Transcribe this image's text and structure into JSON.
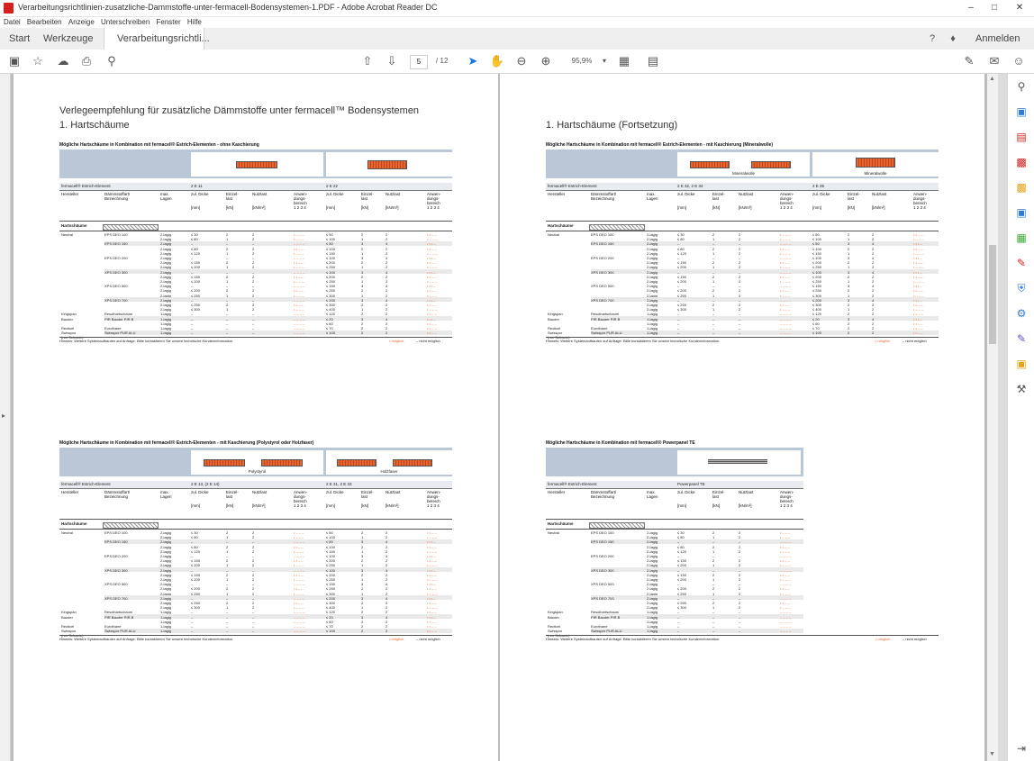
{
  "window": {
    "title": "Verarbeitungsrichtlinien-zusatzliche-Dammstoffe-unter-fermacell-Bodensystemen-1.PDF - Adobe Acrobat Reader DC"
  },
  "menu": [
    "Datei",
    "Bearbeiten",
    "Anzeige",
    "Unterschreiben",
    "Fenster",
    "Hilfe"
  ],
  "tabs": {
    "start": "Start",
    "werkzeuge": "Werkzeuge",
    "doc": "Verarbeitungsrichtli...",
    "close": "×"
  },
  "header_right": {
    "signin": "Anmelden"
  },
  "toolbar": {
    "page_current": "5",
    "page_sep": "/",
    "page_total": "12",
    "zoom": "95,9%"
  },
  "page_left": {
    "title1": "Verlegeempfehlung für zusätzliche Dämmstoffe unter fermacell™ Bodensystemen",
    "title2": "1. Hartschäume",
    "t1": {
      "caption": "Mögliche Hartschäume in Kombination mit fermacell® Estrich-Elementen - ohne Kaschierung",
      "elem_label": "fermacell® Estrich-Element",
      "elem_a": "2 E 11",
      "elem_b": "2 E 22"
    },
    "t2": {
      "caption": "Mögliche Hartschäume in Kombination mit fermacell® Estrich-Elementen - mit Kaschierung (Polystyrol oder Holzfaser)",
      "elem_label": "fermacell® Estrich-Element",
      "elem_a": "2 E 13, (2 E 14)",
      "elem_b": "2 E 31, 2 E 33",
      "img_a": "Polystyrol",
      "img_b": "Holzfaser"
    }
  },
  "page_right": {
    "title2": "1. Hartschäume (Fortsetzung)",
    "t1": {
      "caption": "Mögliche Hartschäume in Kombination mit fermacell® Estrich-Elementen - mit Kaschierung (Mineralwolle)",
      "elem_label": "fermacell® Estrich-Element",
      "elem_a": "2 E 32, 2 E 34",
      "elem_b": "2 E 35",
      "img_a": "Mineralwolle",
      "img_b": "Mineralwolle"
    },
    "t2": {
      "caption": "Mögliche Hartschäume in Kombination mit fermacell® Powerpanel TE",
      "elem_label": "fermacell® Estrich-Element",
      "elem_a": "Powerpanel TE"
    }
  },
  "table_common": {
    "hersteller": "Hersteller",
    "daemm": "Dämmstoffart/\nBezeichnung",
    "lagen": "max.\nLagen",
    "dicke": "zul. Dicke\n\n\n[mm]",
    "einzel": "Einzel-\nlast\n\n[kN]",
    "nutz": "Nutzlast\n\n\n[kN/m²]",
    "anw": "Anwen-\ndungs-\nbereich\n1 2 3 4",
    "group": "Hartschäume",
    "makers": [
      "Neutral",
      "Kingspan",
      "Bauder",
      "Recticel",
      "Swisspor\n(nur Schweiz)"
    ],
    "products": [
      "EPS DEO 100",
      "EPS DEO 150",
      "EPS DEO 200",
      "XPS DEO 300",
      "XPS DEO 500",
      "XPS DEO 700",
      "Resolhartschaum\nKooltherm Q3",
      "PIR Bauder PIR B",
      "Eurothane\nFB - ALV",
      "Swisspor PUR ALU"
    ],
    "note": "Hinweis: Weitere Systemaufbauten auf Anfrage. Bitte kontaktieren Sie unsere technische Kundeninformation.",
    "legend_pos": "• möglich",
    "legend_neg": "– nicht möglich"
  },
  "rows": [
    [
      "2-lagig",
      "≤ 30",
      "2",
      "2",
      "• – – –"
    ],
    [
      "2-lagig",
      "≤ 80",
      "1",
      "2",
      "• – – –"
    ],
    [
      "2-lagig",
      "–",
      "–",
      "–",
      "– – – –"
    ],
    [
      "2-lagig",
      "≤ 80",
      "2",
      "2",
      "• • – –"
    ],
    [
      "2-lagig",
      "≤ 120",
      "1",
      "2",
      "• – – –"
    ],
    [
      "2-lagig",
      "–",
      "–",
      "–",
      "– – – –"
    ],
    [
      "2-lagig",
      "≤ 150",
      "2",
      "2",
      "• • – –"
    ],
    [
      "2-lagig",
      "≤ 200",
      "1",
      "2",
      "• – – –"
    ],
    [
      "2-lagig",
      "–",
      "–",
      "–",
      "– – – –"
    ],
    [
      "2-lagig",
      "≤ 150",
      "2",
      "2",
      "• • – –"
    ],
    [
      "2-lagig",
      "≤ 200",
      "1",
      "2",
      "• – – –"
    ],
    [
      "2-lagig",
      "–",
      "–",
      "–",
      "– – – –"
    ],
    [
      "2-lagig",
      "≤ 200",
      "2",
      "2",
      "• • – –"
    ],
    [
      "2-lagig",
      "≤ 250",
      "1",
      "2",
      "• – – –"
    ],
    [
      "2-lagig",
      "–",
      "–",
      "–",
      "– – – –"
    ],
    [
      "2-lagig",
      "≤ 250",
      "2",
      "2",
      "• • – –"
    ],
    [
      "2-lagig",
      "≤ 300",
      "1",
      "2",
      "• – – –"
    ],
    [
      "1-lagig",
      "–",
      "–",
      "–",
      "– – – –"
    ],
    [
      "1-lagig",
      "–",
      "–",
      "–",
      "– – – –"
    ],
    [
      "1-lagig",
      "–",
      "–",
      "–",
      "– – – –"
    ],
    [
      "1-lagig",
      "–",
      "–",
      "–",
      "– – – –"
    ],
    [
      "1-lagig",
      "–",
      "–",
      "–",
      "– – – –"
    ]
  ],
  "rows_b": [
    [
      "≤ 50",
      "2",
      "2",
      "• • – –"
    ],
    [
      "≤ 100",
      "1",
      "2",
      "• – – –"
    ],
    [
      "≤ 50",
      "3",
      "4",
      "• • • –"
    ],
    [
      "≤ 100",
      "2",
      "2",
      "• • – –"
    ],
    [
      "≤ 150",
      "1",
      "2",
      "• – – –"
    ],
    [
      "≤ 100",
      "3",
      "4",
      "• • • –"
    ],
    [
      "≤ 200",
      "2",
      "2",
      "• • – –"
    ],
    [
      "≤ 250",
      "1",
      "2",
      "• – – –"
    ],
    [
      "≤ 100",
      "3",
      "4",
      "• • • –"
    ],
    [
      "≤ 200",
      "2",
      "2",
      "• • – –"
    ],
    [
      "≤ 250",
      "1",
      "2",
      "• – – –"
    ],
    [
      "≤ 150",
      "3",
      "4",
      "• • • –"
    ],
    [
      "≤ 250",
      "2",
      "2",
      "• • – –"
    ],
    [
      "≤ 300",
      "1",
      "2",
      "• – – –"
    ],
    [
      "≤ 200",
      "3",
      "4",
      "• • • –"
    ],
    [
      "≤ 300",
      "2",
      "2",
      "• • – –"
    ],
    [
      "≤ 400",
      "1",
      "2",
      "• – – –"
    ],
    [
      "≤ 120",
      "2",
      "2",
      "• • – –"
    ],
    [
      "≤ 20",
      "3",
      "4",
      "• • • –"
    ],
    [
      "≤ 60",
      "2",
      "2",
      "• • – –"
    ],
    [
      "≤ 70",
      "2",
      "2",
      "• • – –"
    ],
    [
      "≤ 100",
      "2",
      "2",
      "• • – –"
    ]
  ]
}
